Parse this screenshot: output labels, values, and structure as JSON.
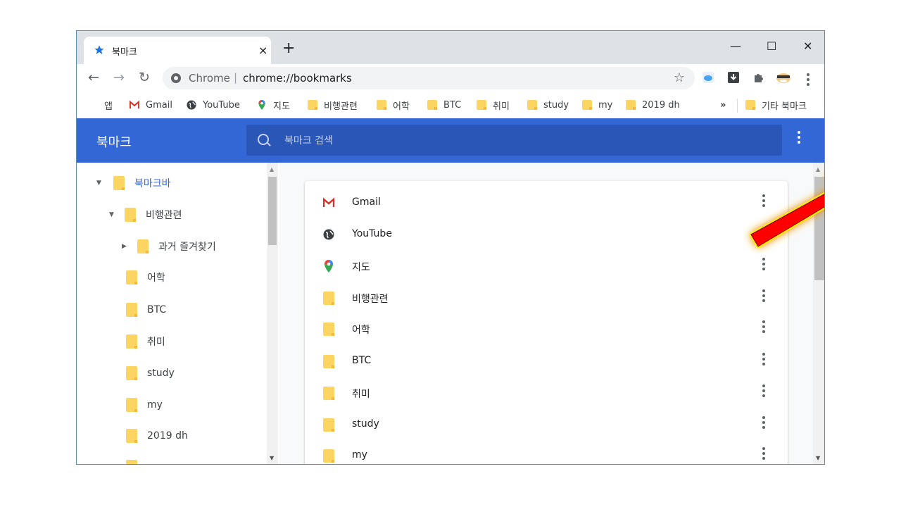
{
  "tab": {
    "title": "북마크",
    "close": "×",
    "new_tab": "+"
  },
  "window_controls": {
    "minimize": "—",
    "maximize": "☐",
    "close": "✕"
  },
  "toolbar": {
    "back": "←",
    "forward": "→",
    "reload": "↻",
    "site_label": "Chrome",
    "separator": "|",
    "url": "chrome://bookmarks",
    "bookmark_star": "☆"
  },
  "bookmarks_bar": {
    "items": [
      {
        "label": "앱",
        "icon": "apps-icon"
      },
      {
        "label": "Gmail",
        "icon": "gmail-icon"
      },
      {
        "label": "YouTube",
        "icon": "globe-icon"
      },
      {
        "label": "지도",
        "icon": "maps-icon"
      },
      {
        "label": "비행관련",
        "icon": "folder-icon"
      },
      {
        "label": "어학",
        "icon": "folder-icon"
      },
      {
        "label": "BTC",
        "icon": "folder-icon"
      },
      {
        "label": "취미",
        "icon": "folder-icon"
      },
      {
        "label": "study",
        "icon": "folder-icon"
      },
      {
        "label": "my",
        "icon": "folder-icon"
      },
      {
        "label": "2019 dh",
        "icon": "folder-icon"
      }
    ],
    "overflow": "»",
    "other_bookmarks": "기타 북마크"
  },
  "header": {
    "title": "북마크",
    "search_placeholder": "북마크 검색"
  },
  "sidebar": {
    "items": [
      {
        "label": "북마크바",
        "arrow": "▼"
      },
      {
        "label": "비행관련",
        "arrow": "▼"
      },
      {
        "label": "과거 즐겨찾기",
        "arrow": "▶"
      },
      {
        "label": "어학",
        "arrow": ""
      },
      {
        "label": "BTC",
        "arrow": ""
      },
      {
        "label": "취미",
        "arrow": ""
      },
      {
        "label": "study",
        "arrow": ""
      },
      {
        "label": "my",
        "arrow": ""
      },
      {
        "label": "2019 dh",
        "arrow": ""
      }
    ]
  },
  "list": {
    "items": [
      {
        "title": "Gmail",
        "icon": "gmail-icon"
      },
      {
        "title": "YouTube",
        "icon": "globe-icon"
      },
      {
        "title": "지도",
        "icon": "maps-icon"
      },
      {
        "title": "비행관련",
        "icon": "folder-icon"
      },
      {
        "title": "어학",
        "icon": "folder-icon"
      },
      {
        "title": "BTC",
        "icon": "folder-icon"
      },
      {
        "title": "취미",
        "icon": "folder-icon"
      },
      {
        "title": "study",
        "icon": "folder-icon"
      },
      {
        "title": "my",
        "icon": "folder-icon"
      }
    ]
  },
  "colors": {
    "header_blue": "#3367d6",
    "search_bg": "#2a56b8",
    "folder": "#fcd462",
    "arrow": "#ff0000"
  }
}
